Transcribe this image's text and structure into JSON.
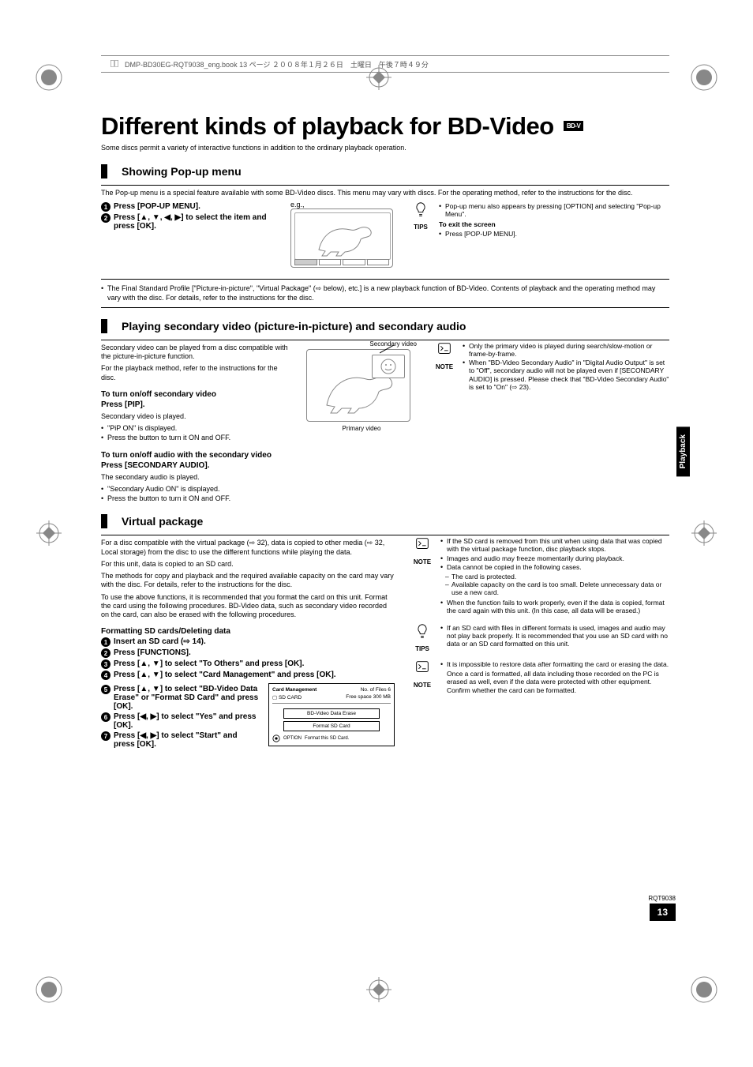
{
  "header_strip": "DMP-BD30EG-RQT9038_eng.book  13 ページ  ２００８年１月２６日　土曜日　午後７時４９分",
  "title": "Different kinds of playback for BD-Video",
  "badge": "BD-V",
  "intro": "Some discs permit a variety of interactive functions in addition to the ordinary playback operation.",
  "side_tab": "Playback",
  "page_code": "RQT9038",
  "page_num": "13",
  "section1": {
    "title": "Showing Pop-up menu",
    "desc": "The Pop-up menu is a special feature available with some BD-Video discs. This menu may vary with discs. For the operating method, refer to the instructions for the disc.",
    "step1": "Press [POP-UP MENU].",
    "step2": "Press [▲, ▼, ◀, ▶] to select the item and press [OK].",
    "eg": "e.g.,",
    "tip_label": "TIPS",
    "tip1": "Pop-up menu also appears by pressing [OPTION] and selecting \"Pop-up Menu\".",
    "tip_head": "To exit the screen",
    "tip2": "Press [POP-UP MENU].",
    "fsp": "The Final Standard Profile [\"Picture-in-picture\", \"Virtual Package\" (⇨ below), etc.] is a new playback function of BD-Video. Contents of playback and the operating method may vary with the disc. For details, refer to the instructions for the disc."
  },
  "section2": {
    "title": "Playing secondary video (picture-in-picture) and secondary audio",
    "p1": "Secondary video can be played from a disc compatible with the picture-in-picture function.",
    "p2": "For the playback method, refer to the instructions for the disc.",
    "h1": "To turn on/off secondary video",
    "h1cmd": "Press [PIP].",
    "h1l1": "Secondary video is played.",
    "h1b1": "\"PiP ON\" is displayed.",
    "h1b2": "Press the button to turn it ON and OFF.",
    "h2": "To turn on/off audio with the secondary video",
    "h2cmd": "Press [SECONDARY AUDIO].",
    "h2l1": "The secondary audio is played.",
    "h2b1": "\"Secondary Audio ON\" is displayed.",
    "h2b2": "Press the button to turn it ON and OFF.",
    "lbl_secondary": "Secondary video",
    "lbl_primary": "Primary video",
    "note_label": "NOTE",
    "n1": "Only the primary video is played during search/slow-motion or frame-by-frame.",
    "n2": "When \"BD-Video Secondary Audio\" in \"Digital Audio Output\" is set to \"Off\", secondary audio will not be played even if [SECONDARY AUDIO] is pressed. Please check that \"BD-Video Secondary Audio\" is set to \"On\" (⇨ 23)."
  },
  "section3": {
    "title": "Virtual package",
    "p1": "For a disc compatible with the virtual package (⇨ 32), data is copied to other media (⇨ 32, Local storage) from the disc to use the different functions while playing the data.",
    "p2": "For this unit, data is copied to an SD card.",
    "p3": "The methods for copy and playback and the required available capacity on the card may vary with the disc. For details, refer to the instructions for the disc.",
    "p4": "To use the above functions, it is recommended that you format the card on this unit. Format the card using the following procedures. BD-Video data, such as secondary video recorded on the card, can also be erased with the following procedures.",
    "fmth": "Formatting SD cards/Deleting data",
    "s1": "Insert an SD card (⇨ 14).",
    "s2": "Press [FUNCTIONS].",
    "s3": "Press [▲, ▼] to select \"To Others\" and press [OK].",
    "s4": "Press [▲, ▼] to select \"Card Management\" and press [OK].",
    "s5": "Press [▲, ▼] to select \"BD-Video Data Erase\" or \"Format SD Card\" and press [OK].",
    "s6": "Press [◀, ▶] to select \"Yes\" and press [OK].",
    "s7": "Press [◀, ▶] to select \"Start\" and press [OK].",
    "cm": {
      "title": "Card Management",
      "sd": "SD CARD",
      "files": "No. of Files   6",
      "space": "Free space   300 MB",
      "btn1": "BD-Video Data Erase",
      "btn2": "Format SD Card",
      "hint_btn": "OPTION",
      "hint": "Format this SD Card."
    },
    "note1_label": "NOTE",
    "n1a": "If the SD card is removed from this unit when using data that was copied with the virtual package function, disc playback stops.",
    "n1b": "Images and audio may freeze momentarily during playback.",
    "n1c": "Data cannot be copied in the following cases.",
    "n1c1": "The card is protected.",
    "n1c2": "Available capacity on the card is too small. Delete unnecessary data or use a new card.",
    "n1d": "When the function fails to work properly, even if the data is copied, format the card again with this unit. (In this case, all data will be erased.)",
    "tips_label": "TIPS",
    "t1": "If an SD card with files in different formats is used, images and audio may not play back properly. It is recommended that you use an SD card with no data or an SD card formatted on this unit.",
    "note2_label": "NOTE",
    "nn1": "It is impossible to restore data after formatting the card or erasing the data.",
    "nn2": "Once a card is formatted, all data including those recorded on the PC is erased as well, even if the data were protected with other equipment.",
    "nn3": "Confirm whether the card can be formatted."
  }
}
